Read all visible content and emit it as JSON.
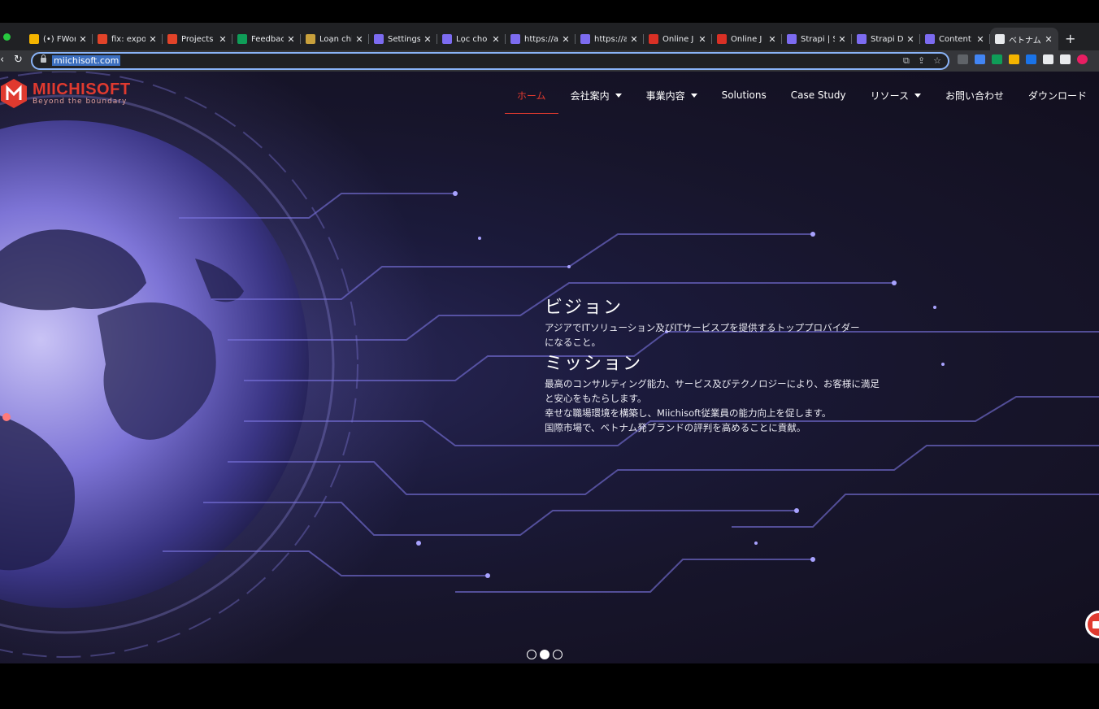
{
  "browser": {
    "tabs": [
      {
        "label": "(•) FWor",
        "favicon_color": "#f4b400",
        "active": false
      },
      {
        "label": "fix: expo",
        "favicon_color": "#e24329",
        "active": false
      },
      {
        "label": "Projects",
        "favicon_color": "#e24329",
        "active": false
      },
      {
        "label": "Feedbac",
        "favicon_color": "#0f9d58",
        "active": false
      },
      {
        "label": "Loạn chi",
        "favicon_color": "#c8a03c",
        "active": false
      },
      {
        "label": "Settings",
        "favicon_color": "#7c6bf0",
        "active": false
      },
      {
        "label": "Lọc cho",
        "favicon_color": "#7c6bf0",
        "active": false
      },
      {
        "label": "https://a",
        "favicon_color": "#7c6bf0",
        "active": false
      },
      {
        "label": "https://a",
        "favicon_color": "#7c6bf0",
        "active": false
      },
      {
        "label": "Online J",
        "favicon_color": "#d93025",
        "active": false
      },
      {
        "label": "Online J",
        "favicon_color": "#d93025",
        "active": false
      },
      {
        "label": "Strapi | S",
        "favicon_color": "#7c6bf0",
        "active": false
      },
      {
        "label": "Strapi D",
        "favicon_color": "#7c6bf0",
        "active": false
      },
      {
        "label": "Content",
        "favicon_color": "#7c6bf0",
        "active": false
      },
      {
        "label": "ベトナム",
        "favicon_color": "#e8eaed",
        "active": true
      }
    ],
    "url": "miichisoft.com",
    "new_tab_label": "+"
  },
  "site": {
    "logo_title": "MIICHISOFT",
    "logo_tagline": "Beyond the boundary",
    "brand_color": "#e03a2f",
    "nav": [
      {
        "label": "ホーム",
        "active": true,
        "dropdown": false
      },
      {
        "label": "会社案内",
        "active": false,
        "dropdown": true
      },
      {
        "label": "事業内容",
        "active": false,
        "dropdown": true
      },
      {
        "label": "Solutions",
        "active": false,
        "dropdown": false
      },
      {
        "label": "Case Study",
        "active": false,
        "dropdown": false
      },
      {
        "label": "リソース",
        "active": false,
        "dropdown": true
      },
      {
        "label": "お問い合わせ",
        "active": false,
        "dropdown": false
      },
      {
        "label": "ダウンロード",
        "active": false,
        "dropdown": false
      }
    ]
  },
  "hero": {
    "vision_heading": "ビジョン",
    "vision_lines": [
      "アジアでITソリューション及びITサービスプを提供するトッププロバイダー",
      "になること。"
    ],
    "mission_heading": "ミッション",
    "mission_lines": [
      "最高のコンサルティング能力、サービス及びテクノロジーにより、お客様に満足",
      "と安心をもたらします。",
      "幸せな職場環境を構築し、Miichisoft従業員の能力向上を促します。",
      "国際市場で、ベトナム発ブランドの評判を高めることに貢献。"
    ],
    "slides_total": 3,
    "slide_active": 2
  }
}
